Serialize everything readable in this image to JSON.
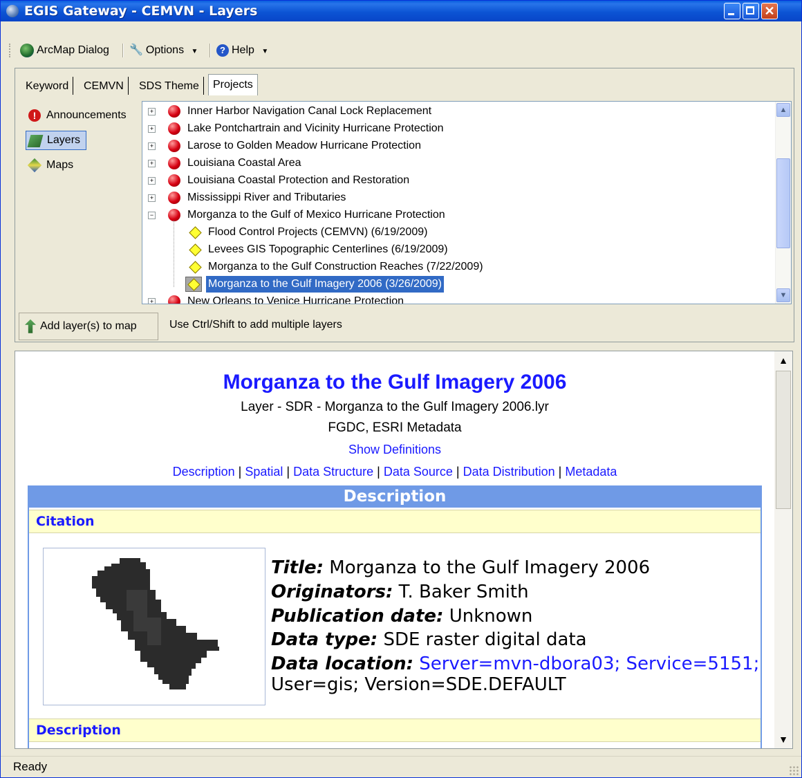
{
  "window": {
    "title": "EGIS Gateway - CEMVN - Layers"
  },
  "toolbar": {
    "arcmap_label": "ArcMap Dialog",
    "options_label": "Options",
    "help_label": "Help"
  },
  "tabs": [
    {
      "label": "Keyword"
    },
    {
      "label": "CEMVN"
    },
    {
      "label": "SDS Theme"
    },
    {
      "label": "Projects"
    }
  ],
  "nav": {
    "announcements": "Announcements",
    "layers": "Layers",
    "maps": "Maps"
  },
  "tree": {
    "items": [
      {
        "label": "Inner Harbor Navigation Canal Lock Replacement"
      },
      {
        "label": "Lake Pontchartrain and Vicinity Hurricane Protection"
      },
      {
        "label": "Larose to Golden Meadow Hurricane Protection"
      },
      {
        "label": "Louisiana Coastal Area"
      },
      {
        "label": "Louisiana Coastal Protection and Restoration"
      },
      {
        "label": "Mississippi River and Tributaries"
      },
      {
        "label": "Morganza to the Gulf of Mexico Hurricane Protection"
      },
      {
        "label": "Flood Control Projects (CEMVN) (6/19/2009)"
      },
      {
        "label": "Levees GIS Topographic Centerlines (6/19/2009)"
      },
      {
        "label": "Morganza to the Gulf Construction Reaches (7/22/2009)"
      },
      {
        "label": "Morganza to the Gulf Imagery 2006 (3/26/2009)"
      },
      {
        "label": "New Orleans to Venice Hurricane Protection"
      }
    ]
  },
  "actions": {
    "add_layer": "Add layer(s) to map",
    "hint": "Use Ctrl/Shift to add multiple layers"
  },
  "metadata": {
    "heading": "Morganza to the Gulf Imagery 2006",
    "layer_line": "Layer - SDR - Morganza to the Gulf Imagery 2006.lyr",
    "format_line": "FGDC, ESRI Metadata",
    "show_definitions": "Show Definitions",
    "links": [
      "Description",
      "Spatial",
      "Data Structure",
      "Data Source",
      "Data Distribution",
      "Metadata"
    ],
    "link_separator": " | ",
    "section_title": "Description",
    "citation_label": "Citation",
    "description_label": "Description",
    "fields": {
      "title_label": "Title:",
      "title_value": "Morganza to the Gulf Imagery 2006",
      "originators_label": "Originators:",
      "originators_value": "T. Baker Smith",
      "pubdate_label": "Publication date:",
      "pubdate_value": "Unknown",
      "datatype_label": "Data type:",
      "datatype_value": "SDE raster digital data",
      "location_label": "Data location:",
      "location_value_1": "Server=mvn-dbora03; Service=5151;",
      "location_value_2": "User=gis; Version=SDE.DEFAULT"
    }
  },
  "status": {
    "text": "Ready"
  },
  "colors": {
    "title_bar": "#0c54d4",
    "link_blue": "#1a1aff",
    "section_bar": "#6f9ae6",
    "section_row": "#ffffcc",
    "selection": "#316ac5",
    "project_dot": "#d60012",
    "layer_diamond": "#ffff33"
  }
}
